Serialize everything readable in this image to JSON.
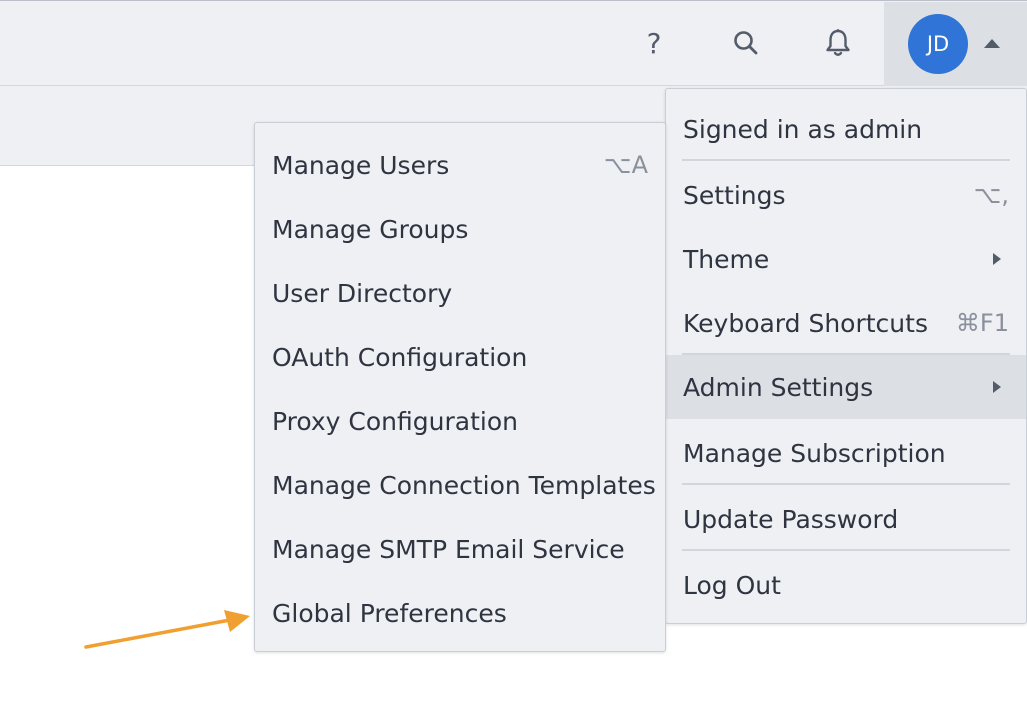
{
  "header": {
    "icons": {
      "help": "?",
      "search": "search-icon",
      "notifications": "bell-icon"
    },
    "user": {
      "initials": "JD",
      "avatar_color": "#2f74d6"
    }
  },
  "user_menu": {
    "signed_in": "Signed in as admin",
    "settings": {
      "label": "Settings",
      "shortcut": "⌥,"
    },
    "theme": {
      "label": "Theme"
    },
    "keyboard_shortcuts": {
      "label": "Keyboard Shortcuts",
      "shortcut": "⌘F1"
    },
    "admin_settings": {
      "label": "Admin Settings"
    },
    "manage_subscription": {
      "label": "Manage Subscription"
    },
    "update_password": {
      "label": "Update Password"
    },
    "log_out": {
      "label": "Log Out"
    }
  },
  "admin_menu": {
    "items": [
      {
        "label": "Manage Users",
        "shortcut": "⌥A"
      },
      {
        "label": "Manage Groups"
      },
      {
        "label": "User Directory"
      },
      {
        "label": "OAuth Configuration"
      },
      {
        "label": "Proxy Configuration"
      },
      {
        "label": "Manage Connection Templates"
      },
      {
        "label": "Manage SMTP Email Service"
      },
      {
        "label": "Global Preferences"
      }
    ]
  },
  "colors": {
    "background": "#eef0f3",
    "active_item": "#dcdfe4",
    "annotation_arrow": "#f0a030"
  }
}
